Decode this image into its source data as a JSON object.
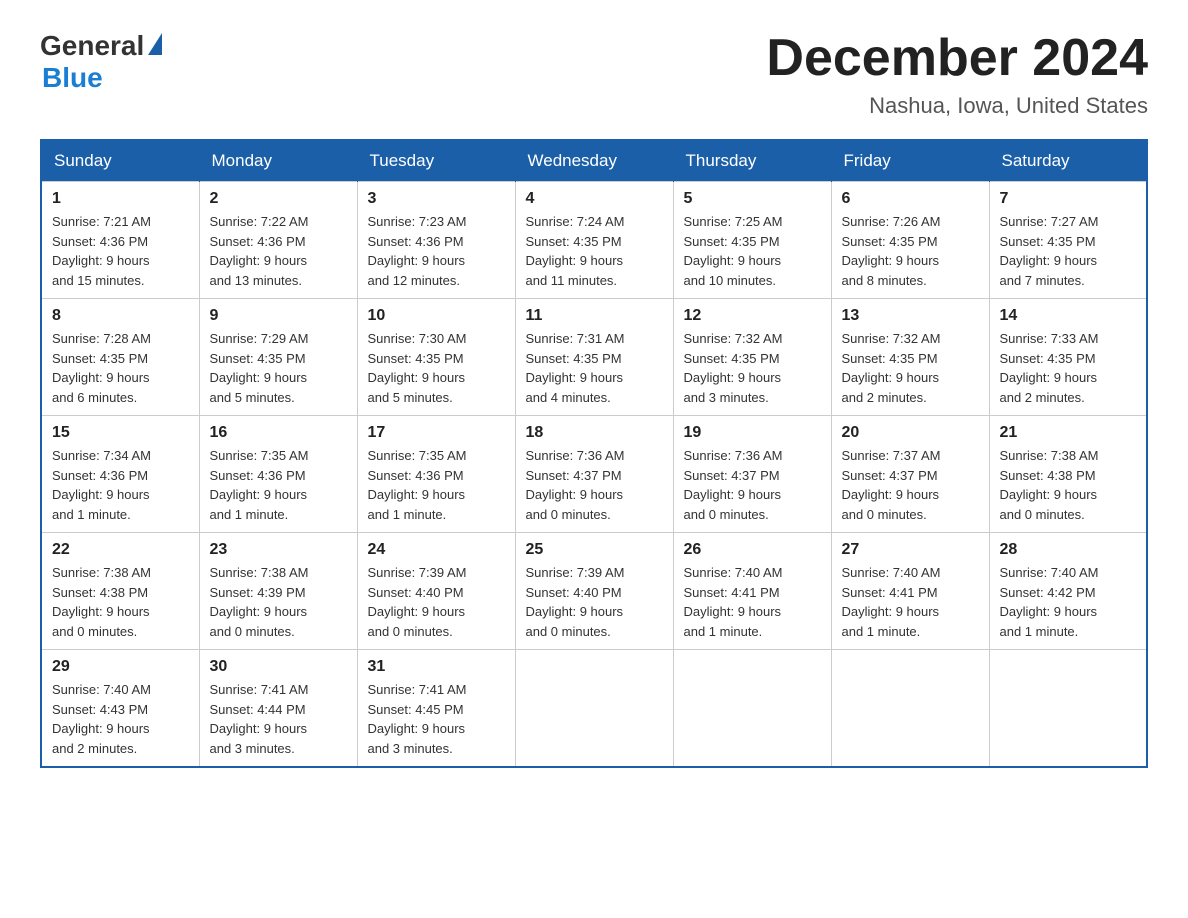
{
  "header": {
    "logo": {
      "general": "General",
      "blue": "Blue"
    },
    "title": "December 2024",
    "location": "Nashua, Iowa, United States"
  },
  "weekdays": [
    "Sunday",
    "Monday",
    "Tuesday",
    "Wednesday",
    "Thursday",
    "Friday",
    "Saturday"
  ],
  "weeks": [
    [
      {
        "day": "1",
        "sunrise": "7:21 AM",
        "sunset": "4:36 PM",
        "daylight": "9 hours and 15 minutes."
      },
      {
        "day": "2",
        "sunrise": "7:22 AM",
        "sunset": "4:36 PM",
        "daylight": "9 hours and 13 minutes."
      },
      {
        "day": "3",
        "sunrise": "7:23 AM",
        "sunset": "4:36 PM",
        "daylight": "9 hours and 12 minutes."
      },
      {
        "day": "4",
        "sunrise": "7:24 AM",
        "sunset": "4:35 PM",
        "daylight": "9 hours and 11 minutes."
      },
      {
        "day": "5",
        "sunrise": "7:25 AM",
        "sunset": "4:35 PM",
        "daylight": "9 hours and 10 minutes."
      },
      {
        "day": "6",
        "sunrise": "7:26 AM",
        "sunset": "4:35 PM",
        "daylight": "9 hours and 8 minutes."
      },
      {
        "day": "7",
        "sunrise": "7:27 AM",
        "sunset": "4:35 PM",
        "daylight": "9 hours and 7 minutes."
      }
    ],
    [
      {
        "day": "8",
        "sunrise": "7:28 AM",
        "sunset": "4:35 PM",
        "daylight": "9 hours and 6 minutes."
      },
      {
        "day": "9",
        "sunrise": "7:29 AM",
        "sunset": "4:35 PM",
        "daylight": "9 hours and 5 minutes."
      },
      {
        "day": "10",
        "sunrise": "7:30 AM",
        "sunset": "4:35 PM",
        "daylight": "9 hours and 5 minutes."
      },
      {
        "day": "11",
        "sunrise": "7:31 AM",
        "sunset": "4:35 PM",
        "daylight": "9 hours and 4 minutes."
      },
      {
        "day": "12",
        "sunrise": "7:32 AM",
        "sunset": "4:35 PM",
        "daylight": "9 hours and 3 minutes."
      },
      {
        "day": "13",
        "sunrise": "7:32 AM",
        "sunset": "4:35 PM",
        "daylight": "9 hours and 2 minutes."
      },
      {
        "day": "14",
        "sunrise": "7:33 AM",
        "sunset": "4:35 PM",
        "daylight": "9 hours and 2 minutes."
      }
    ],
    [
      {
        "day": "15",
        "sunrise": "7:34 AM",
        "sunset": "4:36 PM",
        "daylight": "9 hours and 1 minute."
      },
      {
        "day": "16",
        "sunrise": "7:35 AM",
        "sunset": "4:36 PM",
        "daylight": "9 hours and 1 minute."
      },
      {
        "day": "17",
        "sunrise": "7:35 AM",
        "sunset": "4:36 PM",
        "daylight": "9 hours and 1 minute."
      },
      {
        "day": "18",
        "sunrise": "7:36 AM",
        "sunset": "4:37 PM",
        "daylight": "9 hours and 0 minutes."
      },
      {
        "day": "19",
        "sunrise": "7:36 AM",
        "sunset": "4:37 PM",
        "daylight": "9 hours and 0 minutes."
      },
      {
        "day": "20",
        "sunrise": "7:37 AM",
        "sunset": "4:37 PM",
        "daylight": "9 hours and 0 minutes."
      },
      {
        "day": "21",
        "sunrise": "7:38 AM",
        "sunset": "4:38 PM",
        "daylight": "9 hours and 0 minutes."
      }
    ],
    [
      {
        "day": "22",
        "sunrise": "7:38 AM",
        "sunset": "4:38 PM",
        "daylight": "9 hours and 0 minutes."
      },
      {
        "day": "23",
        "sunrise": "7:38 AM",
        "sunset": "4:39 PM",
        "daylight": "9 hours and 0 minutes."
      },
      {
        "day": "24",
        "sunrise": "7:39 AM",
        "sunset": "4:40 PM",
        "daylight": "9 hours and 0 minutes."
      },
      {
        "day": "25",
        "sunrise": "7:39 AM",
        "sunset": "4:40 PM",
        "daylight": "9 hours and 0 minutes."
      },
      {
        "day": "26",
        "sunrise": "7:40 AM",
        "sunset": "4:41 PM",
        "daylight": "9 hours and 1 minute."
      },
      {
        "day": "27",
        "sunrise": "7:40 AM",
        "sunset": "4:41 PM",
        "daylight": "9 hours and 1 minute."
      },
      {
        "day": "28",
        "sunrise": "7:40 AM",
        "sunset": "4:42 PM",
        "daylight": "9 hours and 1 minute."
      }
    ],
    [
      {
        "day": "29",
        "sunrise": "7:40 AM",
        "sunset": "4:43 PM",
        "daylight": "9 hours and 2 minutes."
      },
      {
        "day": "30",
        "sunrise": "7:41 AM",
        "sunset": "4:44 PM",
        "daylight": "9 hours and 3 minutes."
      },
      {
        "day": "31",
        "sunrise": "7:41 AM",
        "sunset": "4:45 PM",
        "daylight": "9 hours and 3 minutes."
      },
      null,
      null,
      null,
      null
    ]
  ],
  "labels": {
    "sunrise": "Sunrise:",
    "sunset": "Sunset:",
    "daylight": "Daylight:"
  }
}
